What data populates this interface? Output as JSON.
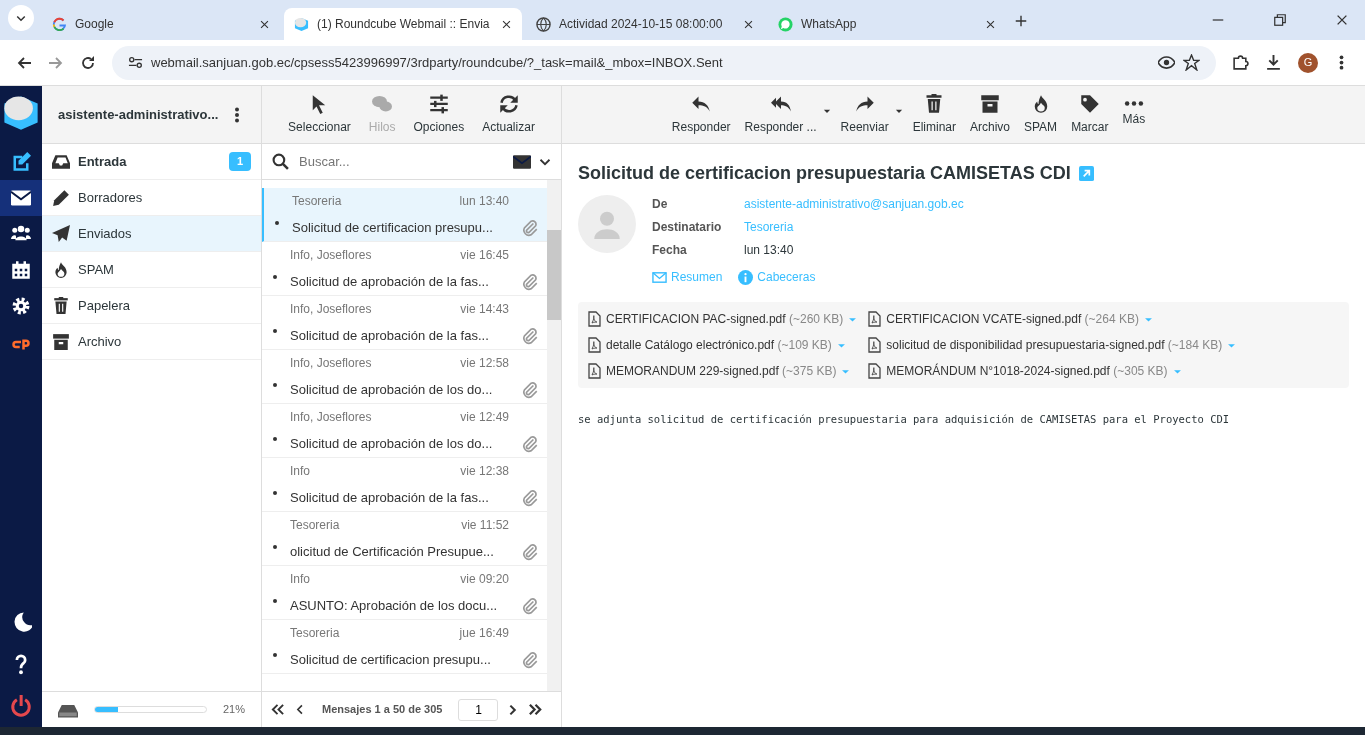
{
  "browser": {
    "tabs": [
      {
        "title": "Google",
        "kind": "google",
        "selected": false
      },
      {
        "title": "(1) Roundcube Webmail :: Envia",
        "kind": "roundcube",
        "selected": true
      },
      {
        "title": "Actividad 2024-10-15 08:00:00",
        "kind": "globe",
        "selected": false
      },
      {
        "title": "WhatsApp",
        "kind": "whatsapp",
        "selected": false
      }
    ],
    "url": "webmail.sanjuan.gob.ec/cpsess5423996997/3rdparty/roundcube/?_task=mail&_mbox=INBOX.Sent",
    "profile_initial": "G"
  },
  "rail": {
    "items": [
      {
        "kind": "compose",
        "selected": false
      },
      {
        "kind": "mail",
        "selected": true
      },
      {
        "kind": "contacts",
        "selected": false
      },
      {
        "kind": "calendar",
        "selected": false
      },
      {
        "kind": "settings",
        "selected": false
      },
      {
        "kind": "cpanel",
        "selected": false
      }
    ],
    "bottom": [
      {
        "kind": "moon"
      },
      {
        "kind": "help"
      },
      {
        "kind": "logout"
      }
    ]
  },
  "account": "asistente-administrativo...",
  "folders": [
    {
      "label": "Entrada",
      "kind": "inbox",
      "unread": true,
      "badge": "1",
      "selected": false
    },
    {
      "label": "Borradores",
      "kind": "drafts",
      "unread": false,
      "selected": false
    },
    {
      "label": "Enviados",
      "kind": "sent",
      "unread": false,
      "selected": true
    },
    {
      "label": "SPAM",
      "kind": "spam",
      "unread": false,
      "selected": false
    },
    {
      "label": "Papelera",
      "kind": "trash",
      "unread": false,
      "selected": false
    },
    {
      "label": "Archivo",
      "kind": "archive",
      "unread": false,
      "selected": false
    }
  ],
  "quota": {
    "level": 0.21,
    "text": "21%"
  },
  "list_toolbar": [
    {
      "label": "Seleccionar",
      "kind": "select",
      "disabled": false
    },
    {
      "label": "Hilos",
      "kind": "threads",
      "disabled": true
    },
    {
      "label": "Opciones",
      "kind": "options",
      "disabled": false
    },
    {
      "label": "Actualizar",
      "kind": "refresh",
      "disabled": false
    }
  ],
  "search": {
    "placeholder": "Buscar..."
  },
  "messages": [
    {
      "from": "Tesoreria",
      "date": "lun 13:40",
      "subject": "Solicitud de certificacion presupu...",
      "selected": true
    },
    {
      "from": "Info, Joseflores",
      "date": "vie 16:45",
      "subject": "Solicitud de aprobación de la fas...",
      "selected": false
    },
    {
      "from": "Info, Joseflores",
      "date": "vie 14:43",
      "subject": "Solicitud de aprobación de la fas...",
      "selected": false
    },
    {
      "from": "Info, Joseflores",
      "date": "vie 12:58",
      "subject": "Solicitud de aprobación de los do...",
      "selected": false
    },
    {
      "from": "Info, Joseflores",
      "date": "vie 12:49",
      "subject": "Solicitud de aprobación de los do...",
      "selected": false
    },
    {
      "from": "Info",
      "date": "vie 12:38",
      "subject": "Solicitud de aprobación de la fas...",
      "selected": false
    },
    {
      "from": "Tesoreria",
      "date": "vie 11:52",
      "subject": "olicitud de Certificación Presupue...",
      "selected": false
    },
    {
      "from": "Info",
      "date": "vie 09:20",
      "subject": "ASUNTO: Aprobación de los docu...",
      "selected": false
    },
    {
      "from": "Tesoreria",
      "date": "jue 16:49",
      "subject": "Solicitud de certificacion presupu...",
      "selected": false
    }
  ],
  "pagination": {
    "text": "Mensajes 1 a 50 de 305",
    "page": "1"
  },
  "toolbar": [
    {
      "label": "Responder",
      "kind": "reply",
      "dropdown": false
    },
    {
      "label": "Responder ...",
      "kind": "reply-all",
      "dropdown": true
    },
    {
      "label": "Reenviar",
      "kind": "forward",
      "dropdown": true
    },
    {
      "label": "Eliminar",
      "kind": "trash",
      "dropdown": false
    },
    {
      "label": "Archivo",
      "kind": "archive",
      "dropdown": false
    },
    {
      "label": "SPAM",
      "kind": "spam",
      "dropdown": false
    },
    {
      "label": "Marcar",
      "kind": "tag",
      "dropdown": false
    },
    {
      "label": "Más",
      "kind": "more",
      "dropdown": false
    }
  ],
  "message": {
    "subject": "Solicitud de certificacion presupuestaria CAMISETAS CDI",
    "headers": [
      {
        "label": "De",
        "value": "asistente-administrativo@sanjuan.gob.ec",
        "link": true
      },
      {
        "label": "Destinatario",
        "value": "Tesoreria",
        "link": true
      },
      {
        "label": "Fecha",
        "value": "lun 13:40",
        "link": false
      }
    ],
    "header_links": [
      {
        "label": "Resumen",
        "kind": "envelope"
      },
      {
        "label": "Cabeceras",
        "kind": "info"
      }
    ],
    "attachments": [
      {
        "name": "CERTIFICACION PAC-signed.pdf",
        "size": "(~260 KB)"
      },
      {
        "name": "CERTIFICACION VCATE-signed.pdf",
        "size": "(~264 KB)"
      },
      {
        "name": "detalle Catálogo electrónico.pdf",
        "size": "(~109 KB)"
      },
      {
        "name": "solicitud de disponibilidad presupuestaria-signed.pdf",
        "size": "(~184 KB)"
      },
      {
        "name": "MEMORANDUM 229-signed.pdf",
        "size": "(~375 KB)"
      },
      {
        "name": "MEMORÁNDUM N°1018-2024-signed.pdf",
        "size": "(~305 KB)"
      }
    ],
    "body": "se adjunta solicitud de certificación presupuestaria para adquisición de CAMISETAS para el Proyecto CDI"
  }
}
